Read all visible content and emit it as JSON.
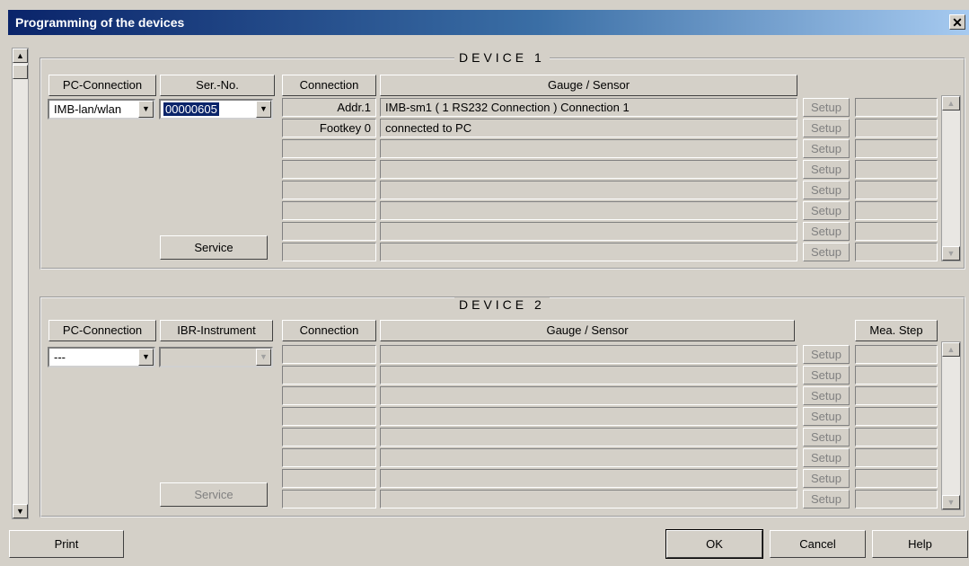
{
  "window": {
    "title": "Programming of the devices",
    "close_glyph": "✕"
  },
  "device1": {
    "title": "DEVICE 1",
    "headers": {
      "pc_connection": "PC-Connection",
      "ser_no": "Ser.-No.",
      "connection": "Connection",
      "gauge_sensor": "Gauge / Sensor"
    },
    "pc_connection_value": "IMB-lan/wlan",
    "ser_no_value": "00000605",
    "rows": [
      {
        "connection": "Addr.1",
        "gauge": "IMB-sm1  ( 1 RS232 Connection )  Connection 1"
      },
      {
        "connection": "Footkey 0",
        "gauge": "connected to PC"
      },
      {
        "connection": "",
        "gauge": ""
      },
      {
        "connection": "",
        "gauge": ""
      },
      {
        "connection": "",
        "gauge": ""
      },
      {
        "connection": "",
        "gauge": ""
      },
      {
        "connection": "",
        "gauge": ""
      },
      {
        "connection": "",
        "gauge": ""
      }
    ],
    "setup_label": "Setup",
    "service_label": "Service"
  },
  "device2": {
    "title": "DEVICE 2",
    "headers": {
      "pc_connection": "PC-Connection",
      "ibr_instrument": "IBR-Instrument",
      "connection": "Connection",
      "gauge_sensor": "Gauge / Sensor",
      "mea_step": "Mea. Step"
    },
    "pc_connection_value": "---",
    "ibr_instrument_value": "",
    "rows": [
      {
        "connection": "",
        "gauge": ""
      },
      {
        "connection": "",
        "gauge": ""
      },
      {
        "connection": "",
        "gauge": ""
      },
      {
        "connection": "",
        "gauge": ""
      },
      {
        "connection": "",
        "gauge": ""
      },
      {
        "connection": "",
        "gauge": ""
      },
      {
        "connection": "",
        "gauge": ""
      },
      {
        "connection": "",
        "gauge": ""
      }
    ],
    "setup_label": "Setup",
    "service_label": "Service"
  },
  "buttons": {
    "print": "Print",
    "ok": "OK",
    "cancel": "Cancel",
    "help": "Help"
  },
  "icons": {
    "scroll_up": "▲",
    "scroll_down": "▼",
    "combo_arrow": "▼"
  },
  "colors": {
    "title_start": "#0a246a",
    "title_end": "#a6caf0",
    "face": "#d4d0c8",
    "selection": "#0a246a"
  }
}
